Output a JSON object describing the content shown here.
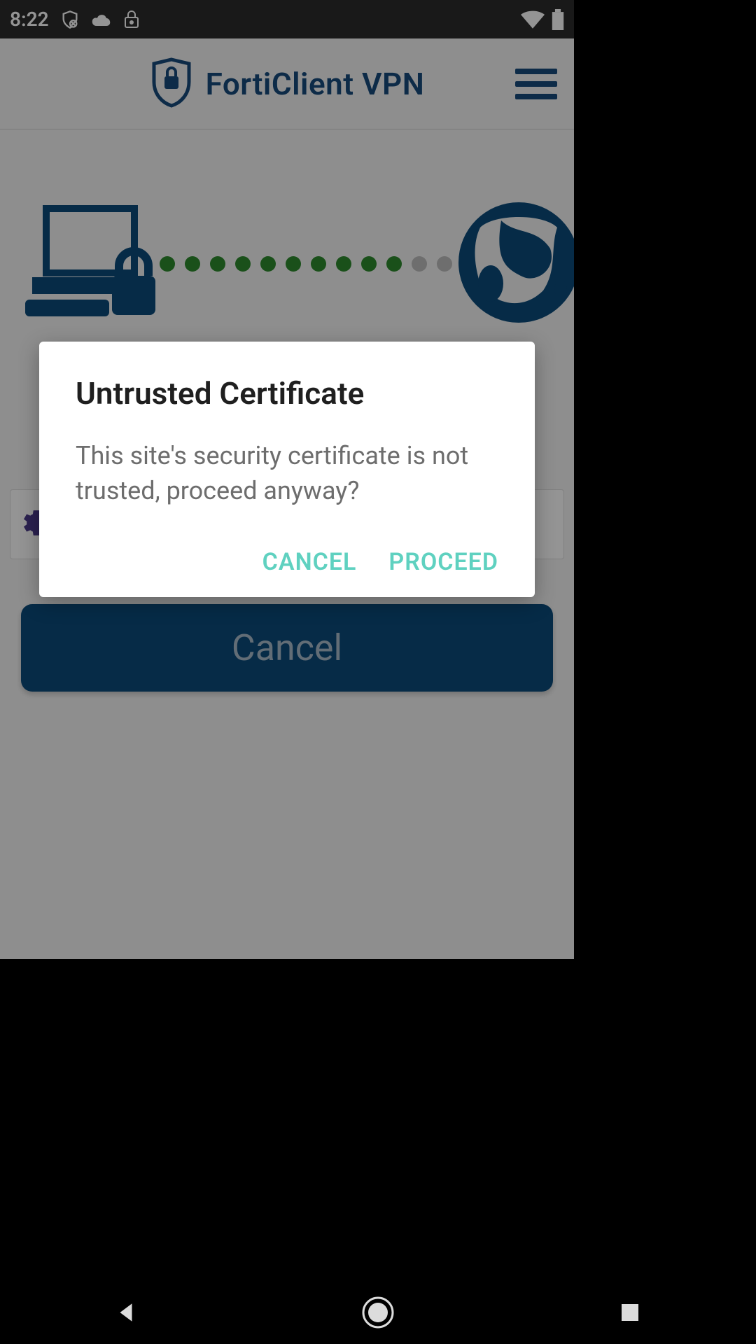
{
  "status": {
    "time": "8:22"
  },
  "header": {
    "title": "FortiClient VPN"
  },
  "connection": {
    "active_dots": 10,
    "inactive_dots": 2
  },
  "main": {
    "cancel_label": "Cancel"
  },
  "dialog": {
    "title": "Untrusted Certificate",
    "body": "This site's security certificate is not trusted, proceed anyway?",
    "cancel": "CANCEL",
    "proceed": "PROCEED"
  },
  "colors": {
    "brand": "#174a7c",
    "accent": "#5fd1c0",
    "dot_active": "#2e8b2e",
    "dot_inactive": "#bdbdbd"
  }
}
